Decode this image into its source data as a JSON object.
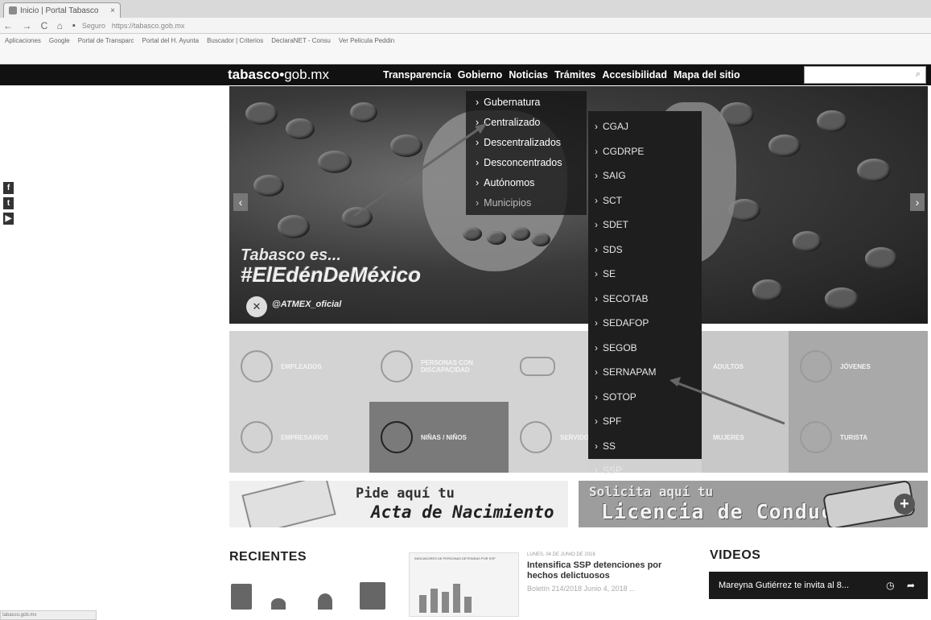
{
  "browser": {
    "tab_title": "Inicio | Portal Tabasco",
    "tab_close": "×",
    "nav_buttons": "← → C ⌂",
    "security": "Seguro",
    "url": "https://tabasco.gob.mx",
    "bookmarks": [
      "Aplicaciones",
      "Google",
      "Portal de Transparc",
      "Portal del H. Ayunta",
      "Buscador | Criterios",
      "DeclaraNET - Consu",
      "Ver Pelicula Peddin"
    ],
    "status_url": "tabasco.gob.mx"
  },
  "site": {
    "logo_bold": "tabasco",
    "logo_dot": "•",
    "logo_rest": "gob.mx",
    "nav": [
      "Transparencia",
      "Gobierno",
      "Noticias",
      "Trámites",
      "Accesibilidad",
      "Mapa del sitio"
    ],
    "search_icon": "⌕"
  },
  "social": [
    "f",
    "t",
    "▶"
  ],
  "hero": {
    "line1": "Tabasco es...",
    "line2": "#ElEdénDeMéxico",
    "handle": "@ATMEX_oficial",
    "prev": "‹",
    "next": "›"
  },
  "gobierno_menu": [
    "Gubernatura",
    "Centralizado",
    "Descentralizados",
    "Desconcentrados",
    "Autónomos",
    "Municipios"
  ],
  "centralizado_menu": [
    "CGAJ",
    "CGDRPE",
    "SAIG",
    "SCT",
    "SDET",
    "SDS",
    "SE",
    "SECOTAB",
    "SEDAFOP",
    "SEGOB",
    "SERNAPAM",
    "SOTOP",
    "SPF",
    "SS",
    "SSP"
  ],
  "caret": "›",
  "tiles": {
    "row1": [
      "EMPLEADOS",
      "PERSONAS CON DISCAPACIDAD",
      "",
      "",
      "ADULTOS",
      "JÓVENES"
    ],
    "row2": [
      "EMPRESARIOS",
      "NIÑAS / NIÑOS",
      "SERVIDORES",
      "",
      "MUJERES",
      "TURISTA"
    ]
  },
  "banners": {
    "acta_line1": "Pide aquí tu",
    "acta_line2": "Acta de Nacimiento",
    "licencia_line1": "Solicita aquí tu",
    "licencia_line2": "Licencia de Conducir",
    "licencia_plus": "+"
  },
  "recientes": {
    "heading": "RECIENTES",
    "news_kicker": "LUNES, 04 DE JUNIO DE 2018",
    "news_title": "Intensifica SSP detenciones por hechos delictuosos",
    "news_meta": "Boletín 214/2018 Junio 4, 2018 ...",
    "infographic_text": "INDICADORES DE PERSONAS DETENIDAS POR SSP"
  },
  "videos": {
    "heading": "VIDEOS",
    "video_title": "Mareyna Gutiérrez te invita al 8...",
    "controls": "◷ ➦"
  }
}
